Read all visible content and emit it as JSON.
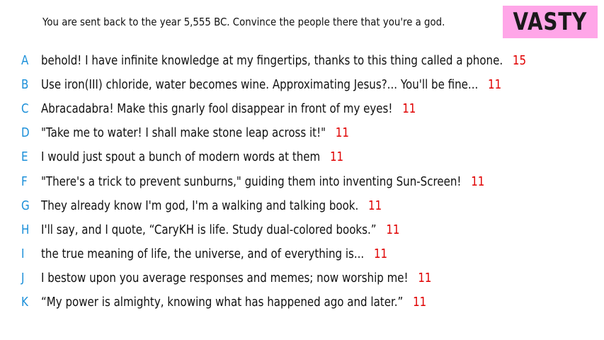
{
  "prompt": "You are sent back to the year 5,555 BC. Convince the people there that you're a god.",
  "badge": {
    "label": "VASTY",
    "color": "#ffa6e8"
  },
  "colors": {
    "letter": "#1a8fd9",
    "score": "#e00000",
    "text": "#111111"
  },
  "responses": [
    {
      "letter": "A",
      "text": "behold! I have infinite knowledge at my fingertips, thanks to this thing called a phone.",
      "score": "15"
    },
    {
      "letter": "B",
      "text": "Use iron(III) chloride, water becomes wine. Approximating Jesus?... You'll be fine...",
      "score": "11"
    },
    {
      "letter": "C",
      "text": "Abracadabra! Make this gnarly fool disappear in front of my eyes!",
      "score": "11"
    },
    {
      "letter": "D",
      "text": "\"Take me to water! I shall make stone leap across it!\"",
      "score": "11"
    },
    {
      "letter": "E",
      "text": "I would just spout a bunch of modern words at them",
      "score": "11"
    },
    {
      "letter": "F",
      "text": "\"There's a trick to prevent sunburns,\" guiding them into inventing Sun-Screen!",
      "score": "11"
    },
    {
      "letter": "G",
      "text": "They already know I'm god, I'm a walking and talking book.",
      "score": "11"
    },
    {
      "letter": "H",
      "text": "I'll say, and I quote, “CaryKH is life. Study dual-colored books.”",
      "score": "11"
    },
    {
      "letter": "I",
      "text": "the true meaning of life, the universe, and of everything is...",
      "score": "11"
    },
    {
      "letter": "J",
      "text": "I bestow upon you average responses and memes; now worship me!",
      "score": "11"
    },
    {
      "letter": "K",
      "text": "“My power is almighty, knowing what has happened ago and later.”",
      "score": "11"
    }
  ]
}
